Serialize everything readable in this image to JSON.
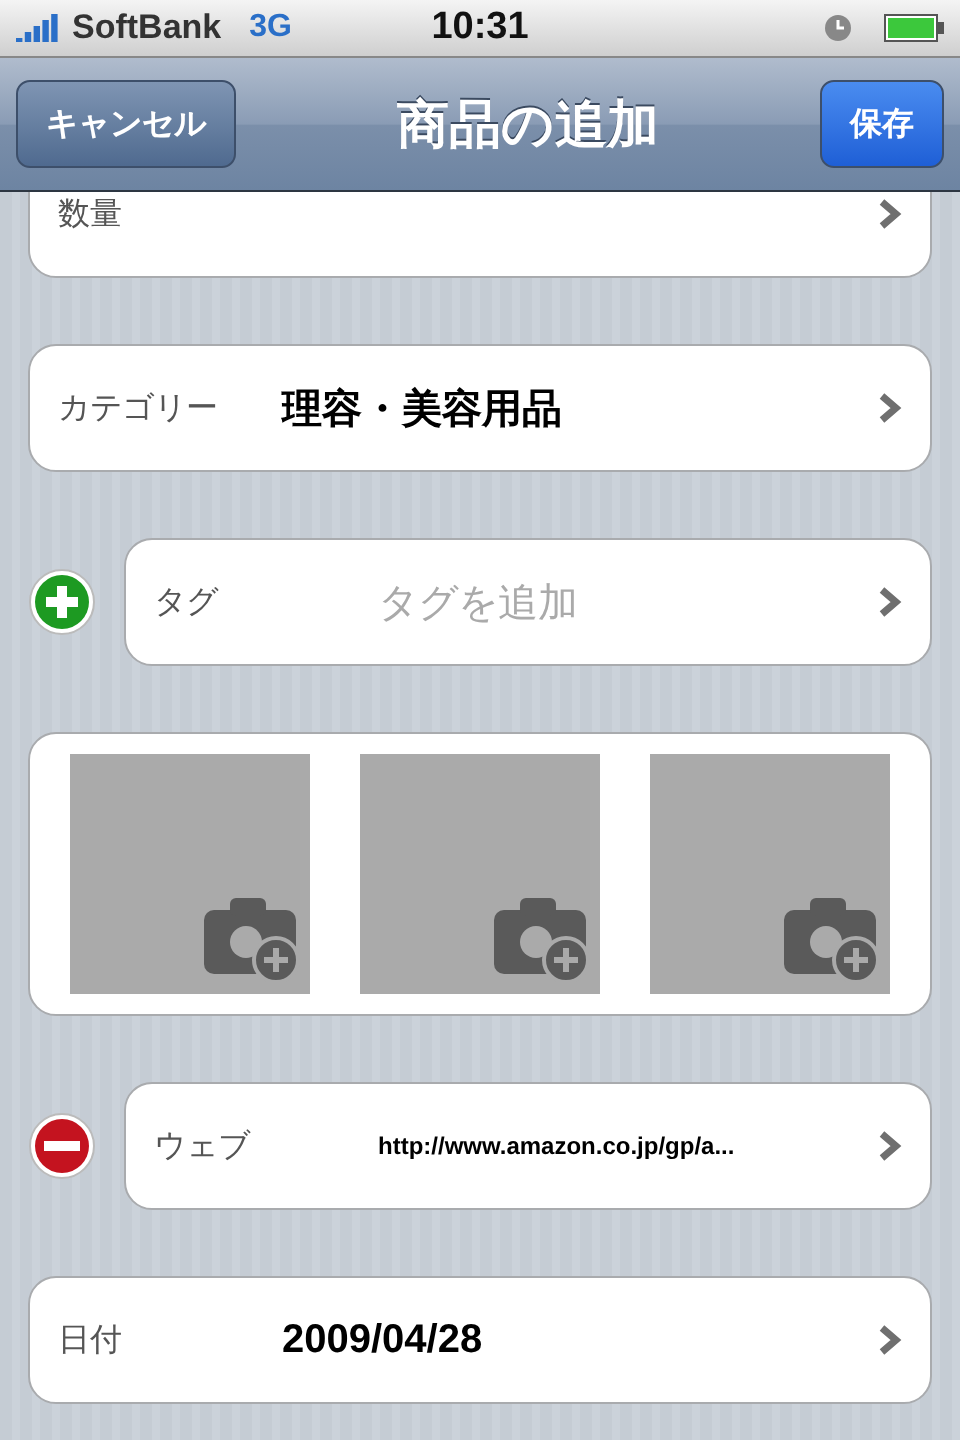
{
  "status_bar": {
    "carrier": "SoftBank",
    "network": "3G",
    "time": "10:31"
  },
  "nav_bar": {
    "title": "商品の追加",
    "left_button": "キャンセル",
    "right_button": "保存"
  },
  "sections": [
    {
      "kind": "row",
      "label": "数量"
    },
    {
      "kind": "row",
      "label": "カテゴリー",
      "value": {
        "kind": "bold",
        "text": "理容・美容用品"
      }
    },
    {
      "kind": "row",
      "label": "タグ",
      "placeholder": "タグを追加",
      "control": {
        "kind": "add"
      }
    },
    {
      "kind": "photos",
      "slots": [
        {
          "kind": "empty"
        },
        {
          "kind": "empty"
        },
        {
          "kind": "empty"
        }
      ]
    },
    {
      "kind": "row",
      "label": "ウェブ",
      "value": {
        "kind": "url",
        "text": "http://www.amazon.co.jp/gp/a..."
      },
      "control": {
        "kind": "remove"
      }
    },
    {
      "kind": "row",
      "label": "日付",
      "value": {
        "kind": "bold",
        "text": "2009/04/28"
      }
    }
  ]
}
